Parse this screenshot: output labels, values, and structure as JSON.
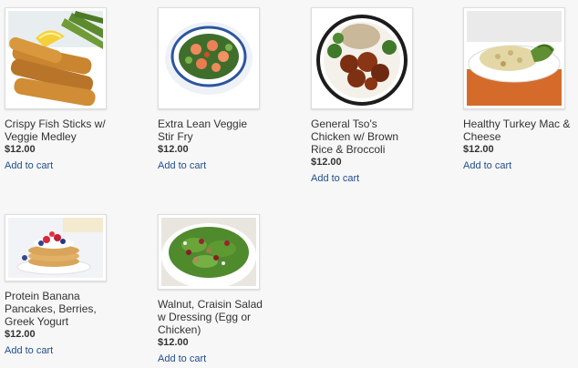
{
  "products": [
    {
      "name": "Crispy Fish Sticks w/\nVeggie Medley",
      "price": "$12.00",
      "cart_label": "Add to cart",
      "image_icon": "fish-sticks-asparagus-lemon-photo"
    },
    {
      "name": "Extra Lean Veggie\nStir Fry",
      "price": "$12.00",
      "cart_label": "Add to cart",
      "image_icon": "shrimp-veggie-stir-fry-bowl-photo"
    },
    {
      "name": "General Tso's\nChicken w/ Brown\nRice & Broccoli",
      "price": "$12.00",
      "cart_label": "Add to cart",
      "image_icon": "general-tso-chicken-rice-broccoli-photo"
    },
    {
      "name": "Healthy Turkey Mac &\nCheese",
      "price": "$12.00",
      "cart_label": "Add to cart",
      "image_icon": "turkey-mac-cheese-plate-photo"
    },
    {
      "name": "Protein Banana\nPancakes, Berries,\nGreek Yogurt",
      "price": "$12.00",
      "cart_label": "Add to cart",
      "image_icon": "banana-pancakes-berries-photo"
    },
    {
      "name": "Walnut, Craisin Salad\nw Dressing (Egg or\nChicken)",
      "price": "$12.00",
      "cart_label": "Add to cart",
      "image_icon": "walnut-craisin-salad-photo"
    }
  ],
  "colors": {
    "link": "#1f4e8c",
    "text": "#333333",
    "background": "#f7f7f7"
  }
}
